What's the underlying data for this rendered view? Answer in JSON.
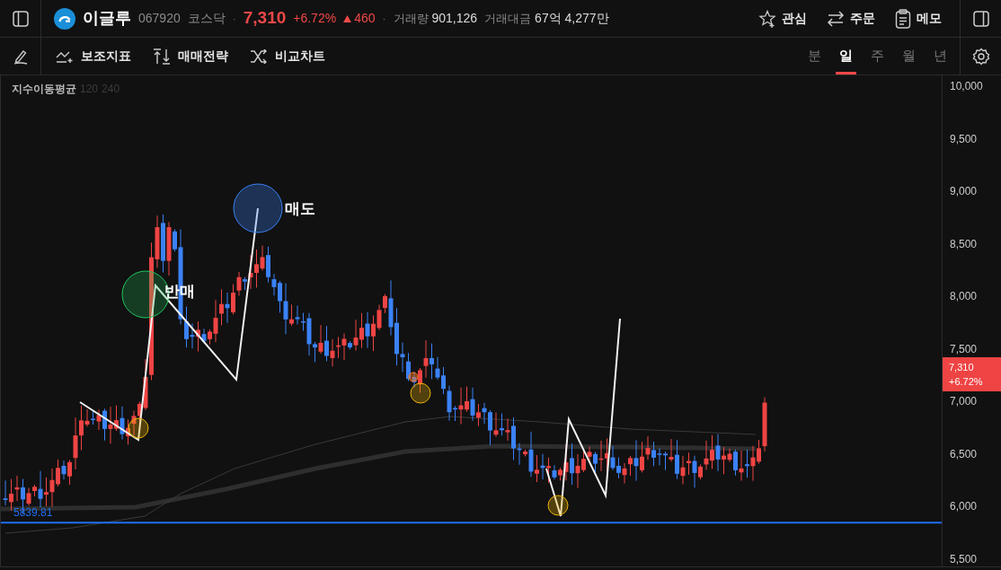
{
  "header": {
    "name": "이글루",
    "code": "067920",
    "market": "코스닥",
    "price": "7,310",
    "change_pct": "+6.72%",
    "change": "460",
    "volume_label": "거래량",
    "volume": "901,126",
    "amount_label": "거래대금",
    "amount": "67억 4,277만",
    "separators": [
      "·",
      "·"
    ],
    "actions": [
      {
        "kind": "star",
        "label": "관심"
      },
      {
        "kind": "swap",
        "label": "주문"
      },
      {
        "kind": "memo",
        "label": "메모"
      }
    ]
  },
  "toolbar": {
    "tools": [
      {
        "kind": "indicator",
        "label": "보조지표"
      },
      {
        "kind": "strategy",
        "label": "매매전략"
      },
      {
        "kind": "compare",
        "label": "비교차트"
      }
    ],
    "periods": [
      {
        "label": "분",
        "selected": false
      },
      {
        "label": "일",
        "selected": true
      },
      {
        "label": "주",
        "selected": false
      },
      {
        "label": "월",
        "selected": false
      },
      {
        "label": "년",
        "selected": false
      }
    ]
  },
  "chart": {
    "indicator": "지수이동평균",
    "indicator_params": [
      "120",
      "240"
    ],
    "y_axis": [
      "10,000",
      "9,500",
      "9,000",
      "8,500",
      "8,000",
      "7,500",
      "7,000",
      "6,500",
      "6,000",
      "5,500"
    ],
    "price_tag": {
      "price": "7,310",
      "change": "+6.72%"
    },
    "level_line": "5839.81",
    "notes": [
      {
        "kind": "rebuy",
        "text": "반매"
      },
      {
        "kind": "sell",
        "text": "매도"
      }
    ]
  }
}
